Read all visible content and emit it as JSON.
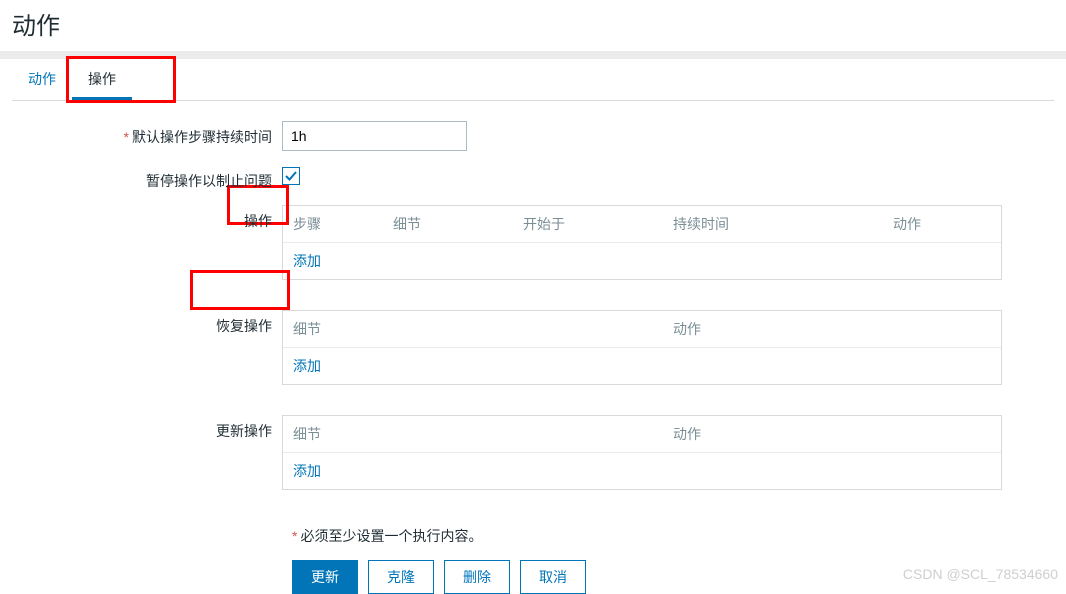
{
  "page_title": "动作",
  "tabs": {
    "t0": "动作",
    "t1": "操作"
  },
  "form": {
    "duration_label": "默认操作步骤持续时间",
    "duration_value": "1h",
    "pause_label": "暂停操作以制止问题"
  },
  "sections": {
    "ops": {
      "label": "操作",
      "headers": {
        "step": "步骤",
        "detail": "细节",
        "start": "开始于",
        "duration": "持续时间",
        "action": "动作"
      },
      "add": "添加"
    },
    "recovery": {
      "label": "恢复操作",
      "headers": {
        "detail": "细节",
        "action": "动作"
      },
      "add": "添加"
    },
    "update": {
      "label": "更新操作",
      "headers": {
        "detail": "细节",
        "action": "动作"
      },
      "add": "添加"
    }
  },
  "validation": "必须至少设置一个执行内容。",
  "buttons": {
    "update": "更新",
    "clone": "克隆",
    "delete": "删除",
    "cancel": "取消"
  },
  "watermark": "CSDN @SCL_78534660"
}
